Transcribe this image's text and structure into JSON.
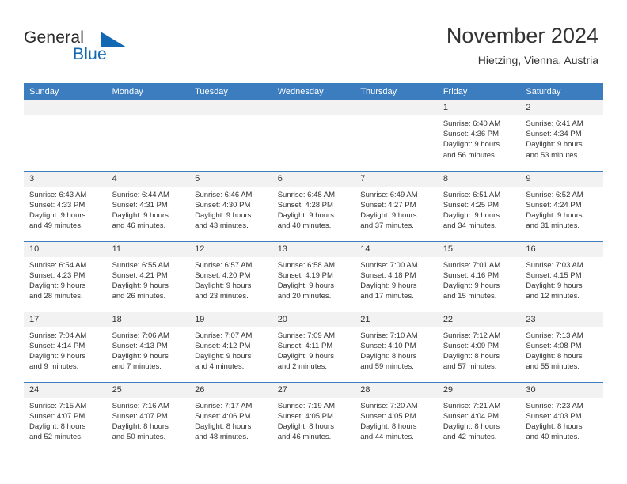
{
  "brand": {
    "word_one": "General",
    "word_two": "Blue",
    "accent_color": "#1268b3"
  },
  "header": {
    "title": "November 2024",
    "location": "Hietzing, Vienna, Austria"
  },
  "theme": {
    "header_blue": "#3b7dbf",
    "daynum_band": "#f2f2f2",
    "text": "#333333"
  },
  "weekday_headers": [
    "Sunday",
    "Monday",
    "Tuesday",
    "Wednesday",
    "Thursday",
    "Friday",
    "Saturday"
  ],
  "labels": {
    "sunrise_prefix": "Sunrise:",
    "sunset_prefix": "Sunset:",
    "daylight_prefix": "Daylight:"
  },
  "weeks": [
    [
      {
        "day": "",
        "sunrise": "",
        "sunset": "",
        "daylight_line1": "",
        "daylight_line2": "",
        "empty": true
      },
      {
        "day": "",
        "sunrise": "",
        "sunset": "",
        "daylight_line1": "",
        "daylight_line2": "",
        "empty": true
      },
      {
        "day": "",
        "sunrise": "",
        "sunset": "",
        "daylight_line1": "",
        "daylight_line2": "",
        "empty": true
      },
      {
        "day": "",
        "sunrise": "",
        "sunset": "",
        "daylight_line1": "",
        "daylight_line2": "",
        "empty": true
      },
      {
        "day": "",
        "sunrise": "",
        "sunset": "",
        "daylight_line1": "",
        "daylight_line2": "",
        "empty": true
      },
      {
        "day": "1",
        "sunrise": "Sunrise: 6:40 AM",
        "sunset": "Sunset: 4:36 PM",
        "daylight_line1": "Daylight: 9 hours",
        "daylight_line2": "and 56 minutes.",
        "empty": false
      },
      {
        "day": "2",
        "sunrise": "Sunrise: 6:41 AM",
        "sunset": "Sunset: 4:34 PM",
        "daylight_line1": "Daylight: 9 hours",
        "daylight_line2": "and 53 minutes.",
        "empty": false
      }
    ],
    [
      {
        "day": "3",
        "sunrise": "Sunrise: 6:43 AM",
        "sunset": "Sunset: 4:33 PM",
        "daylight_line1": "Daylight: 9 hours",
        "daylight_line2": "and 49 minutes.",
        "empty": false
      },
      {
        "day": "4",
        "sunrise": "Sunrise: 6:44 AM",
        "sunset": "Sunset: 4:31 PM",
        "daylight_line1": "Daylight: 9 hours",
        "daylight_line2": "and 46 minutes.",
        "empty": false
      },
      {
        "day": "5",
        "sunrise": "Sunrise: 6:46 AM",
        "sunset": "Sunset: 4:30 PM",
        "daylight_line1": "Daylight: 9 hours",
        "daylight_line2": "and 43 minutes.",
        "empty": false
      },
      {
        "day": "6",
        "sunrise": "Sunrise: 6:48 AM",
        "sunset": "Sunset: 4:28 PM",
        "daylight_line1": "Daylight: 9 hours",
        "daylight_line2": "and 40 minutes.",
        "empty": false
      },
      {
        "day": "7",
        "sunrise": "Sunrise: 6:49 AM",
        "sunset": "Sunset: 4:27 PM",
        "daylight_line1": "Daylight: 9 hours",
        "daylight_line2": "and 37 minutes.",
        "empty": false
      },
      {
        "day": "8",
        "sunrise": "Sunrise: 6:51 AM",
        "sunset": "Sunset: 4:25 PM",
        "daylight_line1": "Daylight: 9 hours",
        "daylight_line2": "and 34 minutes.",
        "empty": false
      },
      {
        "day": "9",
        "sunrise": "Sunrise: 6:52 AM",
        "sunset": "Sunset: 4:24 PM",
        "daylight_line1": "Daylight: 9 hours",
        "daylight_line2": "and 31 minutes.",
        "empty": false
      }
    ],
    [
      {
        "day": "10",
        "sunrise": "Sunrise: 6:54 AM",
        "sunset": "Sunset: 4:23 PM",
        "daylight_line1": "Daylight: 9 hours",
        "daylight_line2": "and 28 minutes.",
        "empty": false
      },
      {
        "day": "11",
        "sunrise": "Sunrise: 6:55 AM",
        "sunset": "Sunset: 4:21 PM",
        "daylight_line1": "Daylight: 9 hours",
        "daylight_line2": "and 26 minutes.",
        "empty": false
      },
      {
        "day": "12",
        "sunrise": "Sunrise: 6:57 AM",
        "sunset": "Sunset: 4:20 PM",
        "daylight_line1": "Daylight: 9 hours",
        "daylight_line2": "and 23 minutes.",
        "empty": false
      },
      {
        "day": "13",
        "sunrise": "Sunrise: 6:58 AM",
        "sunset": "Sunset: 4:19 PM",
        "daylight_line1": "Daylight: 9 hours",
        "daylight_line2": "and 20 minutes.",
        "empty": false
      },
      {
        "day": "14",
        "sunrise": "Sunrise: 7:00 AM",
        "sunset": "Sunset: 4:18 PM",
        "daylight_line1": "Daylight: 9 hours",
        "daylight_line2": "and 17 minutes.",
        "empty": false
      },
      {
        "day": "15",
        "sunrise": "Sunrise: 7:01 AM",
        "sunset": "Sunset: 4:16 PM",
        "daylight_line1": "Daylight: 9 hours",
        "daylight_line2": "and 15 minutes.",
        "empty": false
      },
      {
        "day": "16",
        "sunrise": "Sunrise: 7:03 AM",
        "sunset": "Sunset: 4:15 PM",
        "daylight_line1": "Daylight: 9 hours",
        "daylight_line2": "and 12 minutes.",
        "empty": false
      }
    ],
    [
      {
        "day": "17",
        "sunrise": "Sunrise: 7:04 AM",
        "sunset": "Sunset: 4:14 PM",
        "daylight_line1": "Daylight: 9 hours",
        "daylight_line2": "and 9 minutes.",
        "empty": false
      },
      {
        "day": "18",
        "sunrise": "Sunrise: 7:06 AM",
        "sunset": "Sunset: 4:13 PM",
        "daylight_line1": "Daylight: 9 hours",
        "daylight_line2": "and 7 minutes.",
        "empty": false
      },
      {
        "day": "19",
        "sunrise": "Sunrise: 7:07 AM",
        "sunset": "Sunset: 4:12 PM",
        "daylight_line1": "Daylight: 9 hours",
        "daylight_line2": "and 4 minutes.",
        "empty": false
      },
      {
        "day": "20",
        "sunrise": "Sunrise: 7:09 AM",
        "sunset": "Sunset: 4:11 PM",
        "daylight_line1": "Daylight: 9 hours",
        "daylight_line2": "and 2 minutes.",
        "empty": false
      },
      {
        "day": "21",
        "sunrise": "Sunrise: 7:10 AM",
        "sunset": "Sunset: 4:10 PM",
        "daylight_line1": "Daylight: 8 hours",
        "daylight_line2": "and 59 minutes.",
        "empty": false
      },
      {
        "day": "22",
        "sunrise": "Sunrise: 7:12 AM",
        "sunset": "Sunset: 4:09 PM",
        "daylight_line1": "Daylight: 8 hours",
        "daylight_line2": "and 57 minutes.",
        "empty": false
      },
      {
        "day": "23",
        "sunrise": "Sunrise: 7:13 AM",
        "sunset": "Sunset: 4:08 PM",
        "daylight_line1": "Daylight: 8 hours",
        "daylight_line2": "and 55 minutes.",
        "empty": false
      }
    ],
    [
      {
        "day": "24",
        "sunrise": "Sunrise: 7:15 AM",
        "sunset": "Sunset: 4:07 PM",
        "daylight_line1": "Daylight: 8 hours",
        "daylight_line2": "and 52 minutes.",
        "empty": false
      },
      {
        "day": "25",
        "sunrise": "Sunrise: 7:16 AM",
        "sunset": "Sunset: 4:07 PM",
        "daylight_line1": "Daylight: 8 hours",
        "daylight_line2": "and 50 minutes.",
        "empty": false
      },
      {
        "day": "26",
        "sunrise": "Sunrise: 7:17 AM",
        "sunset": "Sunset: 4:06 PM",
        "daylight_line1": "Daylight: 8 hours",
        "daylight_line2": "and 48 minutes.",
        "empty": false
      },
      {
        "day": "27",
        "sunrise": "Sunrise: 7:19 AM",
        "sunset": "Sunset: 4:05 PM",
        "daylight_line1": "Daylight: 8 hours",
        "daylight_line2": "and 46 minutes.",
        "empty": false
      },
      {
        "day": "28",
        "sunrise": "Sunrise: 7:20 AM",
        "sunset": "Sunset: 4:05 PM",
        "daylight_line1": "Daylight: 8 hours",
        "daylight_line2": "and 44 minutes.",
        "empty": false
      },
      {
        "day": "29",
        "sunrise": "Sunrise: 7:21 AM",
        "sunset": "Sunset: 4:04 PM",
        "daylight_line1": "Daylight: 8 hours",
        "daylight_line2": "and 42 minutes.",
        "empty": false
      },
      {
        "day": "30",
        "sunrise": "Sunrise: 7:23 AM",
        "sunset": "Sunset: 4:03 PM",
        "daylight_line1": "Daylight: 8 hours",
        "daylight_line2": "and 40 minutes.",
        "empty": false
      }
    ]
  ]
}
